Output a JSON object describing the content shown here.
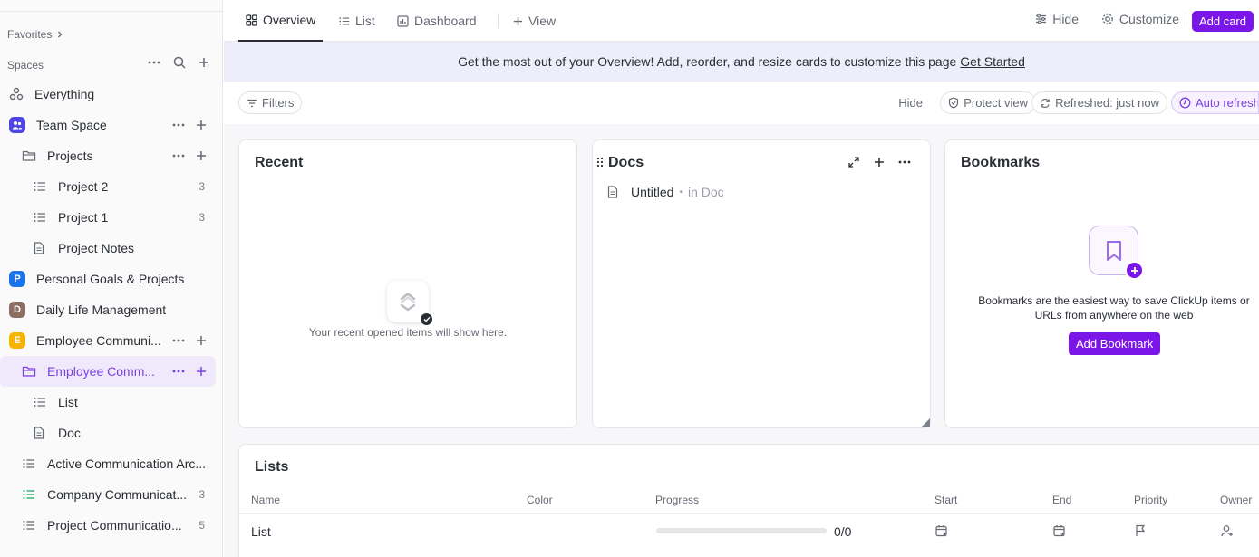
{
  "sidebar": {
    "favorites_label": "Favorites",
    "spaces_label": "Spaces",
    "items": [
      {
        "label": "Everything",
        "icon": "everything-icon"
      },
      {
        "label": "Team Space",
        "avatar_color": "#4f46e5"
      },
      {
        "label": "Projects",
        "icon": "folder-icon"
      },
      {
        "label": "Project 2",
        "count": "3",
        "icon": "list-icon"
      },
      {
        "label": "Project 1",
        "count": "3",
        "icon": "list-icon"
      },
      {
        "label": "Project Notes",
        "icon": "doc-icon"
      },
      {
        "label": "Personal Goals & Projects",
        "avatar_letter": "P",
        "avatar_color": "#1a73e8"
      },
      {
        "label": "Daily Life Management",
        "avatar_letter": "D",
        "avatar_color": "#8d6e63"
      },
      {
        "label": "Employee Communi...",
        "avatar_letter": "E",
        "avatar_color": "#f6b400"
      },
      {
        "label": "Employee Comm...",
        "icon": "folder-icon"
      },
      {
        "label": "List",
        "icon": "list-icon"
      },
      {
        "label": "Doc",
        "icon": "doc-icon"
      },
      {
        "label": "Active Communication Arc...",
        "icon": "list-icon"
      },
      {
        "label": "Company Communicat...",
        "count": "3",
        "icon": "list-icon",
        "icon_color": "#1aa35a"
      },
      {
        "label": "Project Communicatio...",
        "count": "5",
        "icon": "list-icon"
      }
    ]
  },
  "topbar": {
    "tabs": [
      "Overview",
      "List",
      "Dashboard"
    ],
    "add_view": "View",
    "hide": "Hide",
    "customize": "Customize",
    "add_card": "Add card"
  },
  "banner": {
    "text": "Get the most out of your Overview! Add, reorder, and resize cards to customize this page",
    "link": "Get Started"
  },
  "filterbar": {
    "filters": "Filters",
    "hide": "Hide",
    "protect_view": "Protect view",
    "refreshed": "Refreshed: just now",
    "auto_refresh": "Auto refresh"
  },
  "cards": {
    "recent": {
      "title": "Recent",
      "empty_text": "Your recent opened items will show here."
    },
    "docs": {
      "title": "Docs",
      "item_name": "Untitled",
      "item_location": "in Doc"
    },
    "bookmarks": {
      "title": "Bookmarks",
      "description_line1": "Bookmarks are the easiest way to save ClickUp items or",
      "description_line2": "URLs from anywhere on the web",
      "button": "Add Bookmark"
    }
  },
  "lists": {
    "title": "Lists",
    "columns": [
      "Name",
      "Color",
      "Progress",
      "Start",
      "End",
      "Priority",
      "Owner"
    ],
    "rows": [
      {
        "name": "List",
        "progress_text": "0/0",
        "progress": 0
      }
    ]
  },
  "colors": {
    "accent": "#7b16e8",
    "banner_bg": "#eeedfa"
  }
}
